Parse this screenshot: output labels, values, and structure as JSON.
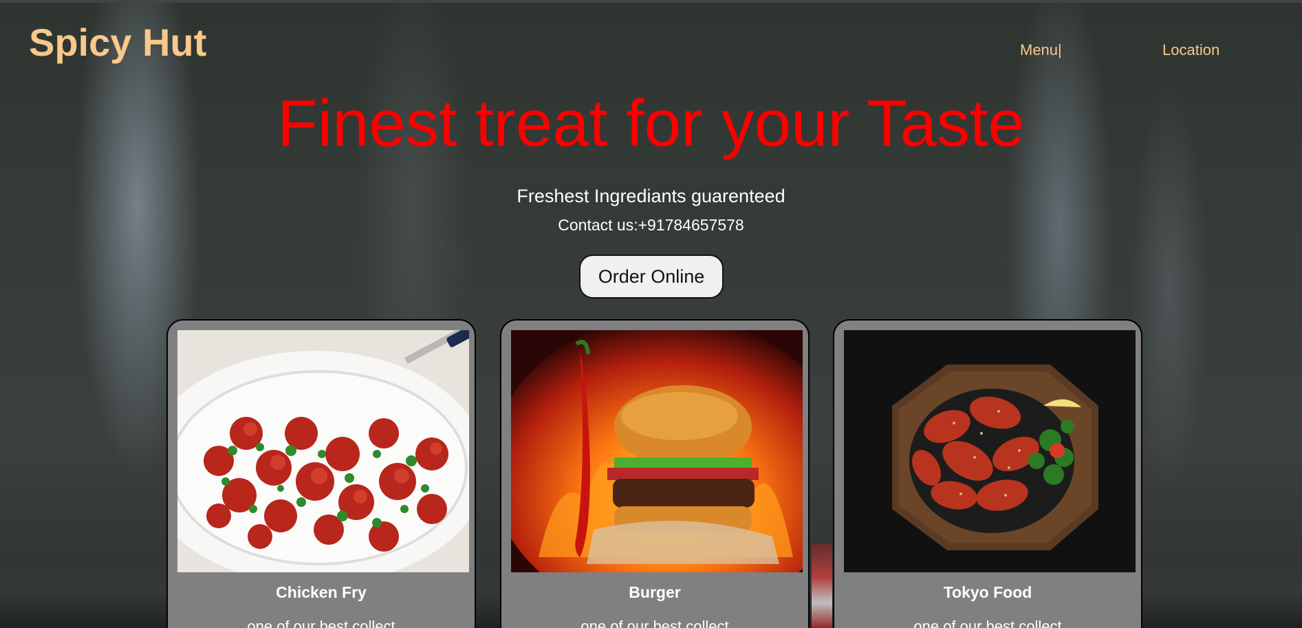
{
  "header": {
    "brand": "Spicy Hut",
    "nav": [
      {
        "label": "Menu|"
      },
      {
        "label": "Location"
      }
    ]
  },
  "hero": {
    "headline": "Finest treat for your Taste",
    "subline": "Freshest Ingrediants guarenteed",
    "contact": "Contact us:+91784657578",
    "order_button": "Order Online"
  },
  "cards": [
    {
      "title": "Chicken Fry",
      "description": "one of our best collect",
      "image": "chicken-fry-photo"
    },
    {
      "title": "Burger",
      "description": "one of our best collect",
      "image": "burger-photo"
    },
    {
      "title": "Tokyo Food",
      "description": "one of our best collect",
      "image": "tokyo-food-photo"
    }
  ],
  "colors": {
    "brand": "#f7c98a",
    "headline": "#ff0000",
    "card_bg": "#808080",
    "button_bg": "#f0f0f0"
  }
}
